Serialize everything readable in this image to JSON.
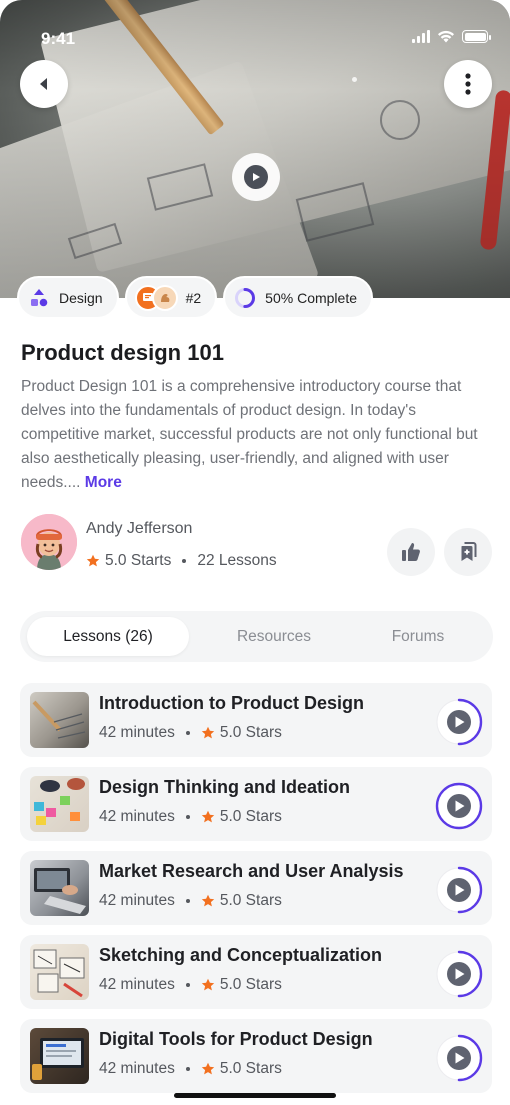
{
  "status_bar": {
    "time": "9:41"
  },
  "hero": {
    "icons": {
      "back": "chevron-left-icon",
      "more": "more-vertical-icon",
      "play": "play-icon"
    }
  },
  "chips": {
    "category": "Design",
    "rank": "#2",
    "progress": "50% Complete",
    "progress_value": 0.5
  },
  "course": {
    "title": "Product design 101",
    "description": "Product Design 101 is a comprehensive introductory course that delves into the fundamentals of product design. In today's competitive market, successful products are not only functional but also aesthetically pleasing, user-friendly, and aligned with user needs....",
    "more_label": "More"
  },
  "author": {
    "name": "Andy Jefferson",
    "rating": "5.0 Starts",
    "lessons": "22 Lessons"
  },
  "tabs": [
    {
      "label": "Lessons (26)",
      "active": true
    },
    {
      "label": "Resources",
      "active": false
    },
    {
      "label": "Forums",
      "active": false
    }
  ],
  "lessons": [
    {
      "title": "Introduction to Product Design",
      "duration": "42 minutes",
      "rating": "5.0 Stars",
      "progress": 0.5
    },
    {
      "title": "Design Thinking and Ideation",
      "duration": "42 minutes",
      "rating": "5.0 Stars",
      "progress": 1.0
    },
    {
      "title": "Market Research and User Analysis",
      "duration": "42 minutes",
      "rating": "5.0 Stars",
      "progress": 0.5
    },
    {
      "title": " Sketching and Conceptualization",
      "duration": "42 minutes",
      "rating": "5.0 Stars",
      "progress": 0.5
    },
    {
      "title": "Digital Tools for Product Design",
      "duration": "42 minutes",
      "rating": "5.0 Stars",
      "progress": 0.5
    }
  ],
  "colors": {
    "accent": "#5b3ae6",
    "star": "#f2701f",
    "card": "#f4f5f6"
  }
}
